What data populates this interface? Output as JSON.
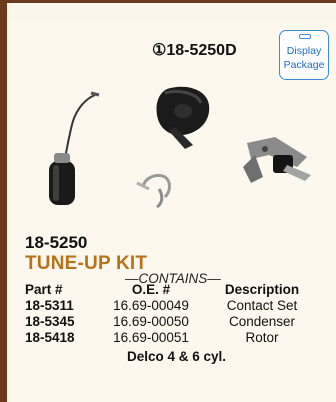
{
  "header": {
    "part_number": "①18-5250D"
  },
  "badge": {
    "line1": "Display",
    "line2": "Package"
  },
  "product": {
    "kit_number": "18-5250",
    "kit_name": "TUNE-UP KIT",
    "contains_label": "—CONTAINS—",
    "application": "Delco 4 & 6 cyl."
  },
  "table": {
    "headers": [
      "Part #",
      "O.E. #",
      "Description"
    ],
    "rows": [
      [
        "18-5311",
        "16.69-00049",
        "Contact Set"
      ],
      [
        "18-5345",
        "16.69-00050",
        "Condenser"
      ],
      [
        "18-5418",
        "16.69-00051",
        "Rotor"
      ]
    ]
  },
  "colors": {
    "frame": "#6b3a1e",
    "kit_name": "#b8731a",
    "badge_blue": "#3a8fd6"
  }
}
